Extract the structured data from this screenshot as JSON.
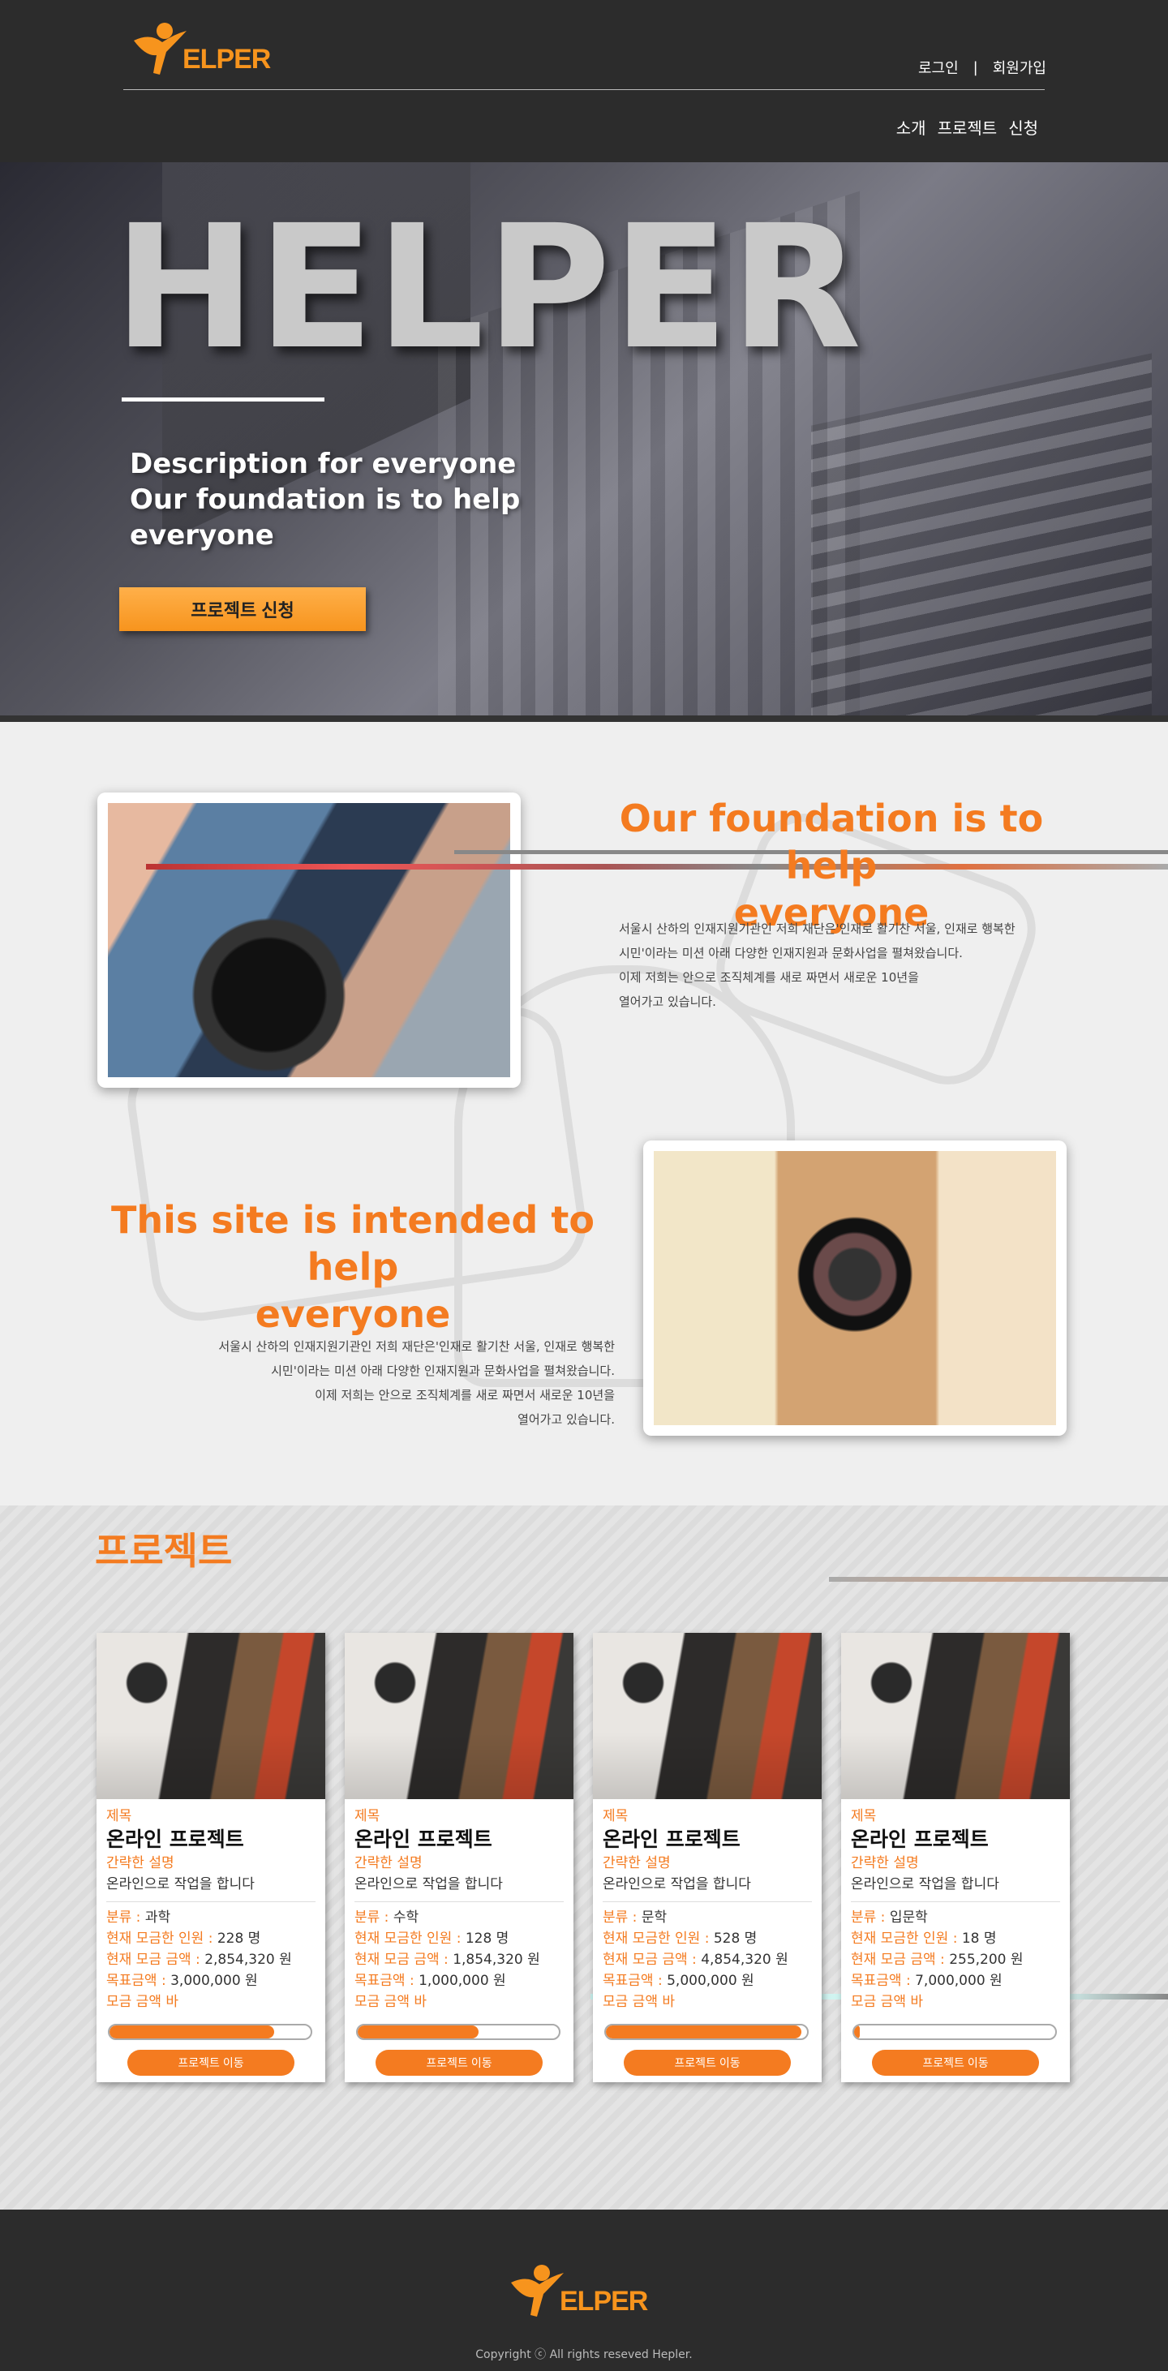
{
  "header": {
    "logo_text": "ELPER",
    "login": "로그인",
    "separator": "|",
    "signup": "회원가입",
    "nav": [
      "소개",
      "프로젝트",
      "신청"
    ]
  },
  "hero": {
    "title": "HELPER",
    "desc_line1": "Description for everyone",
    "desc_line2": "Our foundation is to help",
    "desc_line3": "everyone",
    "button": "프로젝트 신청"
  },
  "about": {
    "block1": {
      "heading_line1": "Our foundation is to help",
      "heading_line2": "everyone",
      "para": [
        "서울시 산하의 인재지원기관인 저희 재단은'인재로 활기찬 서울, 인재로 행복한",
        " 시민'이라는 미션 아래 다양한 인재지원과 문화사업을 펼쳐왔습니다.",
        "이제 저희는 안으로 조직체계를 새로 짜면서 새로운 10년을",
        "열어가고 있습니다."
      ]
    },
    "block2": {
      "heading_line1": "This site is intended to help",
      "heading_line2": "everyone",
      "para": [
        "서울시 산하의 인재지원기관인 저희 재단은'인재로 활기찬 서울, 인재로 행복한",
        "시민'이라는 미션 아래 다양한 인재지원과 문화사업을 펼쳐왔습니다.",
        "이제 저희는 안으로 조직체계를 새로 짜면서 새로운 10년을",
        "열어가고 있습니다."
      ]
    }
  },
  "projects": {
    "title": "프로젝트",
    "label_title": "제목",
    "label_desc": "간략한 설명",
    "label_category": "분류 : ",
    "label_people": "현재 모금한 인원 : ",
    "label_amount": "현재 모금 금액 : ",
    "label_goal": "목표금액 : ",
    "label_bar": "모금 금액 바",
    "cards": [
      {
        "name": "온라인 프로젝트",
        "desc": "온라인으로 작업을 합니다",
        "category": "과학",
        "people": "228 명",
        "amount": "2,854,320 원",
        "goal": "3,000,000 원",
        "progress": 0.82,
        "button": "프로젝트 이동"
      },
      {
        "name": "온라인 프로젝트",
        "desc": "온라인으로 작업을 합니다",
        "category": "수학",
        "people": "128 명",
        "amount": "1,854,320 원",
        "goal": "1,000,000 원",
        "progress": 0.6,
        "button": "프로젝트 이동"
      },
      {
        "name": "온라인 프로젝트",
        "desc": "온라인으로 작업을 합니다",
        "category": "문학",
        "people": "528 명",
        "amount": "4,854,320 원",
        "goal": "5,000,000 원",
        "progress": 0.97,
        "button": "프로젝트 이동"
      },
      {
        "name": "온라인 프로젝트",
        "desc": "온라인으로 작업을 합니다",
        "category": "입문학",
        "people": "18 명",
        "amount": "255,200 원",
        "goal": "7,000,000 원",
        "progress": 0.03,
        "button": "프로젝트 이동"
      }
    ]
  },
  "footer": {
    "logo_text": "ELPER",
    "copyright": "Copyright ⓒ All rights reseved Hepler."
  },
  "colors": {
    "accent": "#f47b20",
    "logo": "#f7941d",
    "header_bg": "#2c2c2c"
  }
}
